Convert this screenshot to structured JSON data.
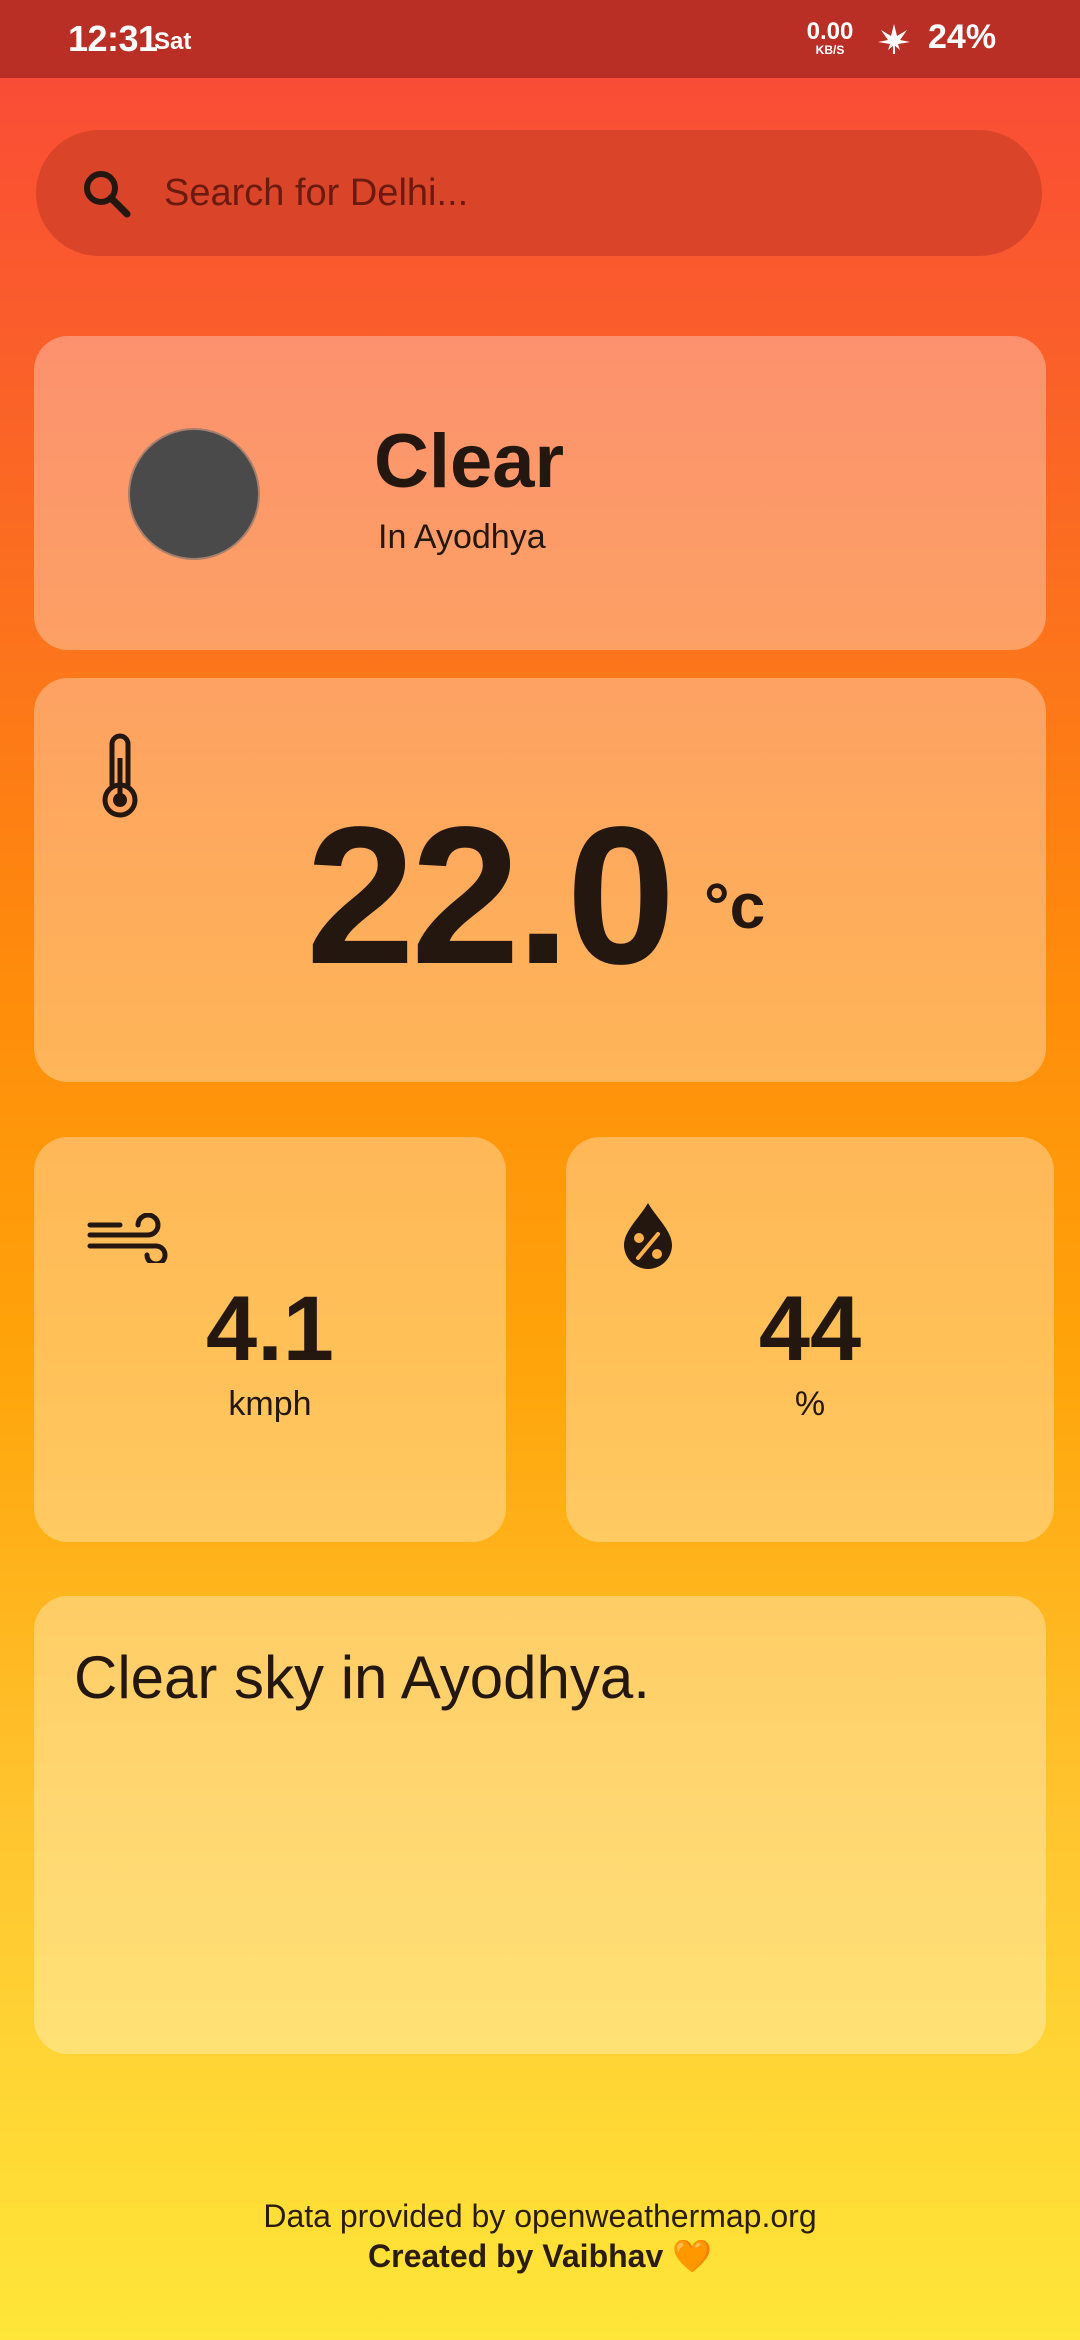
{
  "status_bar": {
    "time": "12:31",
    "day": "Sat",
    "net_speed": "0.00",
    "net_unit": "KB/S",
    "battery": "24%"
  },
  "search": {
    "placeholder": "Search for Delhi..."
  },
  "condition": {
    "title": "Clear",
    "location": "In Ayodhya",
    "icon": "weather-icon-placeholder"
  },
  "temperature": {
    "value": "22.0",
    "unit": "°c",
    "icon": "thermometer-icon"
  },
  "wind": {
    "value": "4.1",
    "unit": "kmph",
    "icon": "wind-icon"
  },
  "humidity": {
    "value": "44",
    "unit": "%",
    "icon": "humidity-drop-icon"
  },
  "description": {
    "text": "Clear sky in Ayodhya."
  },
  "footer": {
    "credit": "Data provided by openweathermap.org",
    "author": "Created by Vaibhav",
    "heart": "🧡"
  },
  "colors": {
    "status_bar": "#b92f25",
    "search_bg": "#da4529",
    "gradient_top": "#f9473a",
    "gradient_mid": "#ff8c0b",
    "gradient_bottom": "#ffe638",
    "text_dark": "#241710"
  }
}
